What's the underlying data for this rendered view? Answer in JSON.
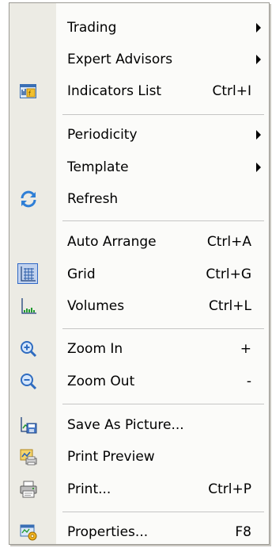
{
  "menu": {
    "items": [
      {
        "label": "Trading",
        "shortcut": "",
        "submenu": true,
        "icon": ""
      },
      {
        "label": "Expert Advisors",
        "shortcut": "",
        "submenu": true,
        "icon": ""
      },
      {
        "label": "Indicators List",
        "shortcut": "Ctrl+I",
        "submenu": false,
        "icon": "indicators-list-icon"
      },
      {
        "label": "Periodicity",
        "shortcut": "",
        "submenu": true,
        "icon": ""
      },
      {
        "label": "Template",
        "shortcut": "",
        "submenu": true,
        "icon": ""
      },
      {
        "label": "Refresh",
        "shortcut": "",
        "submenu": false,
        "icon": "refresh-icon"
      },
      {
        "label": "Auto Arrange",
        "shortcut": "Ctrl+A",
        "submenu": false,
        "icon": ""
      },
      {
        "label": "Grid",
        "shortcut": "Ctrl+G",
        "submenu": false,
        "icon": "grid-icon",
        "checked": true
      },
      {
        "label": "Volumes",
        "shortcut": "Ctrl+L",
        "submenu": false,
        "icon": "volumes-icon"
      },
      {
        "label": "Zoom In",
        "shortcut": "+",
        "submenu": false,
        "icon": "zoom-in-icon"
      },
      {
        "label": "Zoom Out",
        "shortcut": "-",
        "submenu": false,
        "icon": "zoom-out-icon"
      },
      {
        "label": "Save As Picture...",
        "shortcut": "",
        "submenu": false,
        "icon": "save-picture-icon"
      },
      {
        "label": "Print Preview",
        "shortcut": "",
        "submenu": false,
        "icon": "print-preview-icon"
      },
      {
        "label": "Print...",
        "shortcut": "Ctrl+P",
        "submenu": false,
        "icon": "printer-icon"
      },
      {
        "label": "Properties...",
        "shortcut": "F8",
        "submenu": false,
        "icon": "properties-icon"
      }
    ]
  },
  "colors": {
    "gutter": "#ecebe4",
    "menu_bg": "#fbfbf9",
    "border": "#9c9a94",
    "separator": "#c5c5c5",
    "checked_box": "#c1d2ee",
    "checked_border": "#3169c6"
  }
}
